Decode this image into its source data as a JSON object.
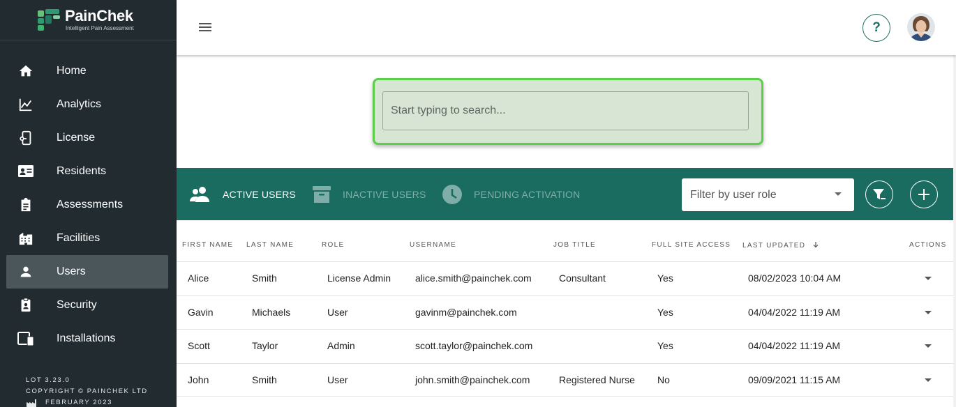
{
  "brand": {
    "name": "PainChek",
    "tagline": "Intelligent Pain Assessment"
  },
  "sidebar": {
    "items": [
      {
        "label": "Home",
        "icon": "home-icon"
      },
      {
        "label": "Analytics",
        "icon": "chart-line-icon"
      },
      {
        "label": "License",
        "icon": "license-icon"
      },
      {
        "label": "Residents",
        "icon": "id-card-icon"
      },
      {
        "label": "Assessments",
        "icon": "clipboard-icon"
      },
      {
        "label": "Facilities",
        "icon": "building-icon"
      },
      {
        "label": "Users",
        "icon": "person-icon",
        "active": true
      },
      {
        "label": "Security",
        "icon": "badge-icon"
      },
      {
        "label": "Installations",
        "icon": "devices-icon"
      }
    ],
    "footer": {
      "lot": "LOT 3.23.0",
      "copyright": "COPYRIGHT © PAINCHEK LTD",
      "date": "FEBRUARY 2023"
    }
  },
  "topbar": {
    "help_label": "?"
  },
  "search": {
    "placeholder": "Start typing to search..."
  },
  "tabs": [
    {
      "label": "ACTIVE USERS",
      "icon": "group-icon",
      "active": true
    },
    {
      "label": "INACTIVE USERS",
      "icon": "archive-icon",
      "active": false
    },
    {
      "label": "PENDING ACTIVATION",
      "icon": "clock-icon",
      "active": false
    }
  ],
  "filter": {
    "placeholder": "Filter by user role"
  },
  "table": {
    "columns": [
      "FIRST NAME",
      "LAST NAME",
      "ROLE",
      "USERNAME",
      "JOB TITLE",
      "FULL SITE ACCESS",
      "LAST UPDATED",
      "ACTIONS"
    ],
    "sort_column": "LAST UPDATED",
    "rows": [
      [
        "Alice",
        "Smith",
        "License Admin",
        "alice.smith@painchek.com",
        "Consultant",
        "Yes",
        "08/02/2023 10:04 AM"
      ],
      [
        "Gavin",
        "Michaels",
        "User",
        "gavinm@painchek.com",
        "",
        "Yes",
        "04/04/2022 11:19 AM"
      ],
      [
        "Scott",
        "Taylor",
        "Admin",
        "scott.taylor@painchek.com",
        "",
        "Yes",
        "04/04/2022 11:19 AM"
      ],
      [
        "John",
        "Smith",
        "User",
        "john.smith@painchek.com",
        "Registered Nurse",
        "No",
        "09/09/2021 11:15 AM"
      ]
    ]
  },
  "colors": {
    "sidebar": "#222b30",
    "accent": "#1a6b60",
    "highlight": "#5bcf4a"
  }
}
